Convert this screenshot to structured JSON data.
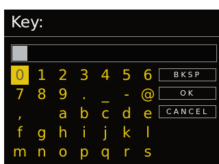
{
  "screen": {
    "title": "Key:",
    "input_value": ""
  },
  "keyboard": {
    "selected": "0",
    "rows": [
      [
        "0",
        "1",
        "2",
        "3",
        "4",
        "5",
        "6"
      ],
      [
        "7",
        "8",
        "9",
        ".",
        "_",
        "-",
        "@"
      ],
      [
        ",",
        "",
        "a",
        "b",
        "c",
        "d",
        "e"
      ],
      [
        "f",
        "g",
        "h",
        "i",
        "j",
        "k",
        "l"
      ],
      [
        "m",
        "n",
        "o",
        "p",
        "q",
        "r",
        "s"
      ]
    ]
  },
  "buttons": {
    "backspace": "BKSP",
    "ok": "OK",
    "cancel": "CANCEL"
  },
  "colors": {
    "key_text": "#e2c411",
    "selection": "#e2c411",
    "background": "#0a0806"
  }
}
